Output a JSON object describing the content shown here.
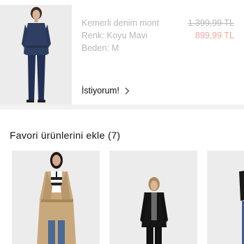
{
  "cart_item": {
    "name": "Kemerli denim mont",
    "color": "Renk: Koyu Mavi",
    "size": "Beden: M",
    "price_old": "1.399,99 TL",
    "price_new": "899,99 TL",
    "wish_label": "İstiyorum!"
  },
  "favorites": {
    "title": "Favori ürünlerini ekle (7)"
  },
  "colors": {
    "muted_text": "#b8b8b8",
    "sale_price": "#f0a8a4",
    "divider": "#f2f2f2",
    "image_bg": "#ececec"
  }
}
